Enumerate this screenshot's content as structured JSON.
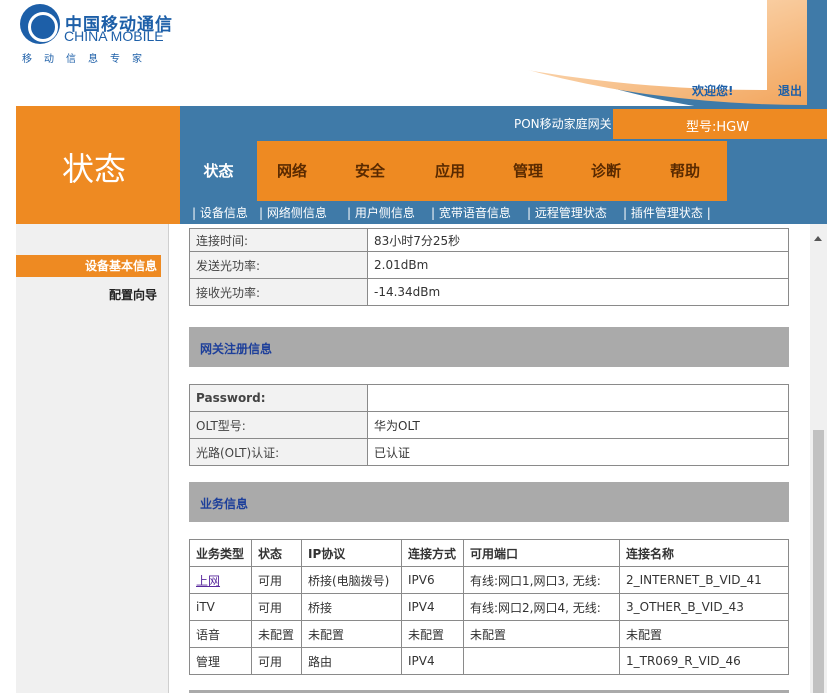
{
  "header": {
    "logo_cn": "中国移动通信",
    "logo_en": "CHINA MOBILE",
    "slogan": "移动信息专家",
    "welcome": "欢迎您!",
    "logout": "退出",
    "product": "PON移动家庭网关",
    "model": "型号:HGW",
    "section_title": "状态"
  },
  "menu": [
    {
      "label": "状态"
    },
    {
      "label": "网络"
    },
    {
      "label": "安全"
    },
    {
      "label": "应用"
    },
    {
      "label": "管理"
    },
    {
      "label": "诊断"
    },
    {
      "label": "帮助"
    }
  ],
  "submenu": [
    {
      "label": "设备信息"
    },
    {
      "label": "网络侧信息"
    },
    {
      "label": "用户侧信息"
    },
    {
      "label": "宽带语音信息"
    },
    {
      "label": "远程管理状态"
    },
    {
      "label": "插件管理状态"
    }
  ],
  "sidebar": {
    "items": [
      {
        "label": "设备基本信息"
      },
      {
        "label": "配置向导"
      }
    ]
  },
  "optical": {
    "rows": [
      {
        "key": "连接时间:",
        "value": "83小时7分25秒"
      },
      {
        "key": "发送光功率:",
        "value": "2.01dBm"
      },
      {
        "key": "接收光功率:",
        "value": "-14.34dBm"
      }
    ]
  },
  "gateway_reg": {
    "title": "网关注册信息",
    "rows": [
      {
        "key": "Password:",
        "value": ""
      },
      {
        "key": "OLT型号:",
        "value": "华为OLT"
      },
      {
        "key": "光路(OLT)认证:",
        "value": "已认证"
      }
    ]
  },
  "service": {
    "title": "业务信息",
    "headers": [
      "业务类型",
      "状态",
      "IP协议",
      "连接方式",
      "可用端口",
      "连接名称"
    ],
    "rows": [
      [
        "上网",
        "可用",
        "桥接(电脑拨号)",
        "IPV6",
        "有线:网口1,网口3, 无线:",
        "2_INTERNET_B_VID_41"
      ],
      [
        "iTV",
        "可用",
        "桥接",
        "IPV4",
        "有线:网口2,网口4, 无线:",
        "3_OTHER_B_VID_43"
      ],
      [
        "语音",
        "未配置",
        "未配置",
        "未配置",
        "未配置",
        "未配置"
      ],
      [
        "管理",
        "可用",
        "路由",
        "IPV4",
        "",
        "1_TR069_R_VID_46"
      ]
    ]
  },
  "colors": {
    "orange": "#ee8a22",
    "blue": "#3f7aa8",
    "section_gray": "#aaaaaa",
    "link": "#5a2a9e"
  }
}
